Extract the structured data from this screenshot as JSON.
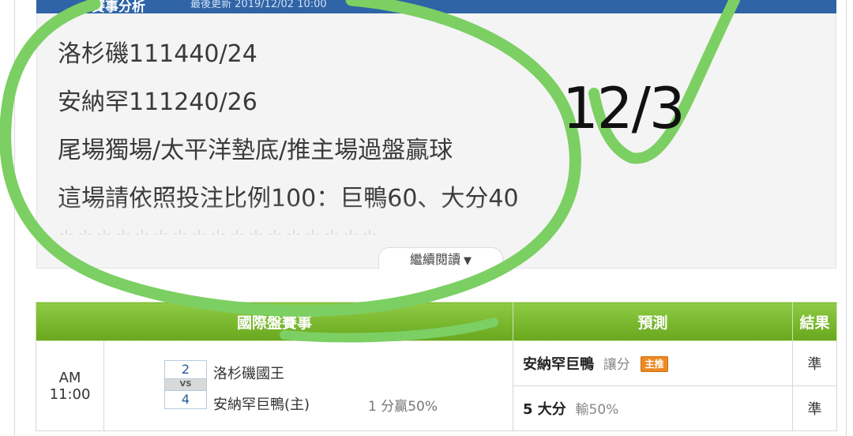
{
  "post": {
    "header_title": "賽事分析",
    "header_meta": "最後更新 2019/12/02 10:00",
    "lines": [
      "洛杉磯111440/24",
      "安納罕111240/26",
      "尾場獨場/太平洋墊底/推主場過盤贏球",
      "這場請依照投注比例100：巨鴨60、大分40"
    ],
    "stars": "＊＊＊＊＊＊＊＊＊＊＊＊＊＊＊＊＊",
    "read_more_label": "繼續閱讀"
  },
  "annotation": {
    "handwritten_text": "12/3",
    "ink_color": "#7ccf63"
  },
  "table": {
    "headers": {
      "match": "國際盤賽事",
      "prediction": "預測",
      "result": "結果"
    },
    "row": {
      "time": "AM 11:00",
      "home_score": "2",
      "vs": "VS",
      "away_score": "4",
      "team1": "洛杉磯國王",
      "team2": "安納罕巨鴨(主)",
      "handicap": "1 分贏50%",
      "predictions": [
        {
          "main": "安納罕巨鴨",
          "sub": "讓分",
          "badge": "主推",
          "result": "準"
        },
        {
          "main": "5 大分",
          "sub": "輸50%",
          "badge": "",
          "result": "準"
        }
      ]
    },
    "colors": {
      "header_green": "#7cba32",
      "result_green": "#4aa214",
      "badge_orange": "#ec8a23"
    }
  }
}
